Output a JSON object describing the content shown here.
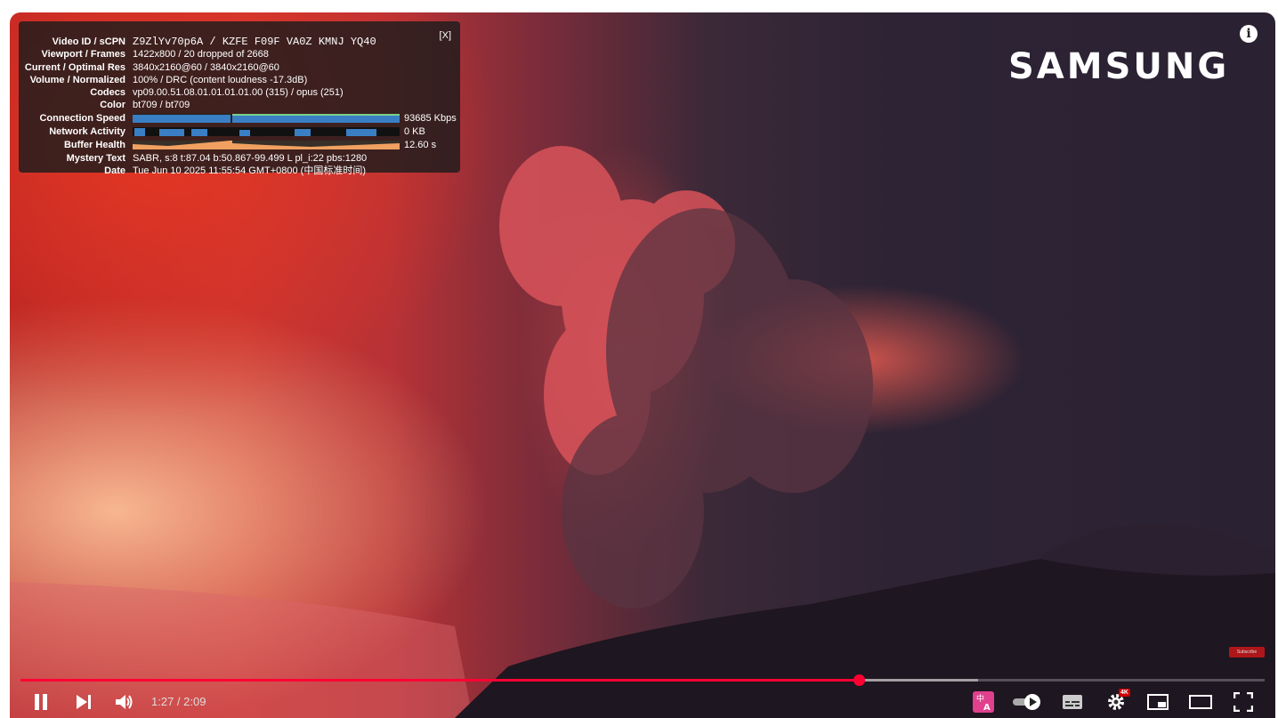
{
  "stats": {
    "rows": [
      {
        "label": "Video ID / sCPN",
        "value": "Z9ZlYv70p6A / KZFE F09F VA0Z KMNJ YQ40"
      },
      {
        "label": "Viewport / Frames",
        "value": "1422x800 / 20 dropped of 2668"
      },
      {
        "label": "Current / Optimal Res",
        "value": "3840x2160@60 / 3840x2160@60"
      },
      {
        "label": "Volume / Normalized",
        "value": "100% / DRC (content loudness -17.3dB)"
      },
      {
        "label": "Codecs",
        "value": "vp09.00.51.08.01.01.01.01.00 (315) / opus (251)"
      },
      {
        "label": "Color",
        "value": "bt709 / bt709"
      },
      {
        "label": "Connection Speed",
        "value": "93685 Kbps"
      },
      {
        "label": "Network Activity",
        "value": "0 KB"
      },
      {
        "label": "Buffer Health",
        "value": "12.60 s"
      },
      {
        "label": "Mystery Text",
        "value": "SABR, s:8 t:87.04 b:50.867-99.499 L pl_i:22 pbs:1280"
      },
      {
        "label": "Date",
        "value": "Tue Jun 10 2025 11:55:54 GMT+0800 (中国标准时间)"
      }
    ],
    "close_label": "[X]",
    "colors": {
      "speed": "#3a7fc4",
      "network": "#3a7fc4",
      "buffer": "#f0a060"
    }
  },
  "overlay": {
    "logo": "SAMSUNG",
    "info_glyph": "i",
    "watermark": "Subscribe"
  },
  "player": {
    "current_time": "1:27",
    "duration": "2:09",
    "time_display": "1:27 / 2:09",
    "progress_fraction": 0.674,
    "buffered_fraction": 0.77,
    "accent_color": "#ff0033",
    "settings_badge": "4K",
    "icons": [
      "pause-icon",
      "next-icon",
      "volume-icon",
      "translate-icon",
      "autoplay-toggle",
      "subtitles-icon",
      "settings-icon",
      "miniplayer-icon",
      "theater-icon",
      "fullscreen-icon"
    ]
  }
}
